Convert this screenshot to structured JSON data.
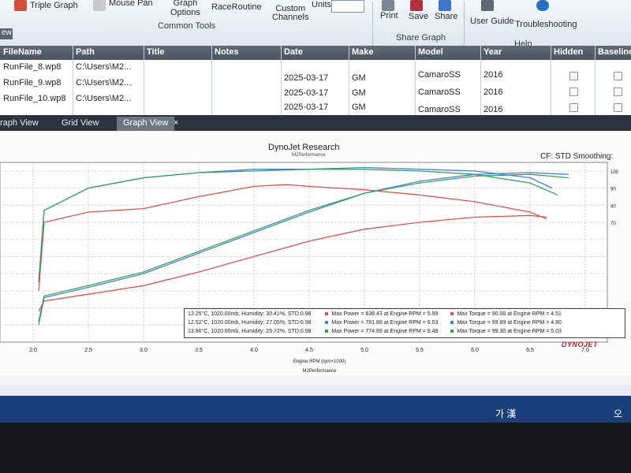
{
  "ribbon": {
    "triple_graph": "Triple Graph",
    "mouse_pan": "Mouse Pan",
    "graph_options": "Graph\nOptions",
    "race_routine": "RaceRoutine",
    "custom_channels": "Custom\nChannels",
    "units": "Units",
    "common_tools": "Common Tools",
    "print": "Print",
    "save": "Save",
    "share": "Share",
    "share_graph": "Share Graph",
    "user_guide": "User Guide",
    "troubleshooting": "Troubleshooting",
    "help": "Help"
  },
  "view_strip": "ew",
  "table": {
    "headers": [
      "FileName",
      "Path",
      "Title",
      "Notes",
      "Date",
      "Make",
      "Model",
      "Year",
      "Hidden",
      "Baseline"
    ],
    "rows": [
      {
        "file": "RunFile_8.wp8",
        "path": "C:\\Users\\M2...",
        "date": "2025-03-17",
        "make": "GM",
        "model": "CamaroSS",
        "year": "2016"
      },
      {
        "file": "RunFile_9.wp8",
        "path": "C:\\Users\\M2...",
        "date": "2025-03-17",
        "make": "GM",
        "model": "CamaroSS",
        "year": "2016"
      },
      {
        "file": "RunFile_10.wp8",
        "path": "C:\\Users\\M2...",
        "date": "2025-03-17",
        "make": "GM",
        "model": "CamaroSS",
        "year": "2016"
      }
    ]
  },
  "tabs": [
    {
      "label": "raph View"
    },
    {
      "label": "Grid View"
    },
    {
      "label": "Graph View"
    }
  ],
  "tab_close": "×",
  "chart_header": {
    "title": "DynoJet Research",
    "subtitle": "M2Performance",
    "cf": "CF: STD Smoothing:"
  },
  "chart_data": {
    "type": "line",
    "title": "DynoJet Research",
    "subtitle": "M2Performance",
    "xlabel": "Engine RPM (rpm×1000)",
    "xlabel2": "M2Performance",
    "xlim": [
      1.7,
      7.2
    ],
    "ylim": [
      0,
      105
    ],
    "x_ticks": [
      "2.0",
      "2.5",
      "3.0",
      "3.5",
      "4.0",
      "4.5",
      "5.0",
      "5.5",
      "6.0",
      "6.5",
      "7.0"
    ],
    "x_tick_values": [
      2.0,
      2.5,
      3.0,
      3.5,
      4.0,
      4.5,
      5.0,
      5.5,
      6.0,
      6.5,
      7.0
    ],
    "y_ticks_right": [
      "100",
      "90",
      "80",
      "70"
    ],
    "y_tick_values": [
      100,
      90,
      80,
      70
    ],
    "grid": true,
    "series": [
      {
        "kind": "torque",
        "color": "#d9534f",
        "x": [
          2.05,
          2.1,
          2.5,
          3.0,
          3.5,
          4.0,
          4.3,
          4.5,
          5.0,
          5.5,
          6.0,
          6.5,
          6.65
        ],
        "y": [
          30,
          70,
          76,
          78,
          85,
          91,
          92,
          91,
          89,
          86,
          82,
          76,
          72
        ]
      },
      {
        "kind": "torque",
        "color": "#4a7fd6",
        "x": [
          2.05,
          2.1,
          2.5,
          3.0,
          3.5,
          4.0,
          4.5,
          5.0,
          5.5,
          6.0,
          6.5,
          6.7
        ],
        "y": [
          35,
          77,
          90,
          96,
          99,
          101,
          101,
          102,
          101,
          100,
          96,
          90
        ]
      },
      {
        "kind": "torque",
        "color": "#3aa062",
        "x": [
          2.05,
          2.1,
          2.5,
          3.0,
          3.5,
          4.0,
          4.5,
          5.0,
          5.5,
          6.0,
          6.5,
          6.75
        ],
        "y": [
          35,
          77,
          90,
          96,
          99,
          100,
          101,
          101,
          100,
          98,
          93,
          86
        ]
      },
      {
        "kind": "power",
        "color": "#d9534f",
        "x": [
          2.05,
          2.1,
          2.5,
          3.0,
          3.5,
          4.0,
          4.5,
          5.0,
          5.5,
          6.0,
          6.5,
          6.65
        ],
        "y": [
          18,
          24,
          28,
          33,
          41,
          50,
          59,
          66,
          70,
          73,
          74,
          73
        ]
      },
      {
        "kind": "power",
        "color": "#4a7fd6",
        "x": [
          2.05,
          2.1,
          2.5,
          3.0,
          3.5,
          4.0,
          4.5,
          5.0,
          5.5,
          6.0,
          6.5,
          6.85
        ],
        "y": [
          10,
          26,
          32,
          40,
          52,
          64,
          76,
          87,
          94,
          98,
          99,
          98
        ]
      },
      {
        "kind": "power",
        "color": "#3aa062",
        "x": [
          2.05,
          2.1,
          2.5,
          3.0,
          3.5,
          4.0,
          4.5,
          5.0,
          5.5,
          6.0,
          6.5,
          6.85
        ],
        "y": [
          12,
          27,
          33,
          41,
          53,
          65,
          77,
          87,
          93,
          97,
          98,
          96
        ]
      }
    ],
    "legend": [
      {
        "color": "#d9534f",
        "conditions": "13.25°C, 1020.00mb, Humidity: 30.41%, STD:0.98",
        "power": "Max Power = 638.43 at Engine RPM = 5.99",
        "torque": "Max Torque = 90.08 at Engine RPM = 4.51"
      },
      {
        "color": "#4a7fd6",
        "conditions": "12.52°C, 1020.00mb, Humidity: 27.05%, STD:0.98",
        "power": "Max Power = 781.88 at Engine RPM = 6.03",
        "torque": "Max Torque = 99.89 at Engine RPM = 4.80"
      },
      {
        "color": "#3aa062",
        "conditions": "13.86°C, 1020.00mb, Humidity: 25.72%, STD:0.98",
        "power": "Max Power = 774.89 at Engine RPM = 6.48",
        "torque": "Max Torque = 99.30 at Engine RPM = 5.03"
      }
    ],
    "logo": "DYNOJET"
  },
  "taskbar": {
    "ime": "가 漢",
    "clock": "오후"
  }
}
